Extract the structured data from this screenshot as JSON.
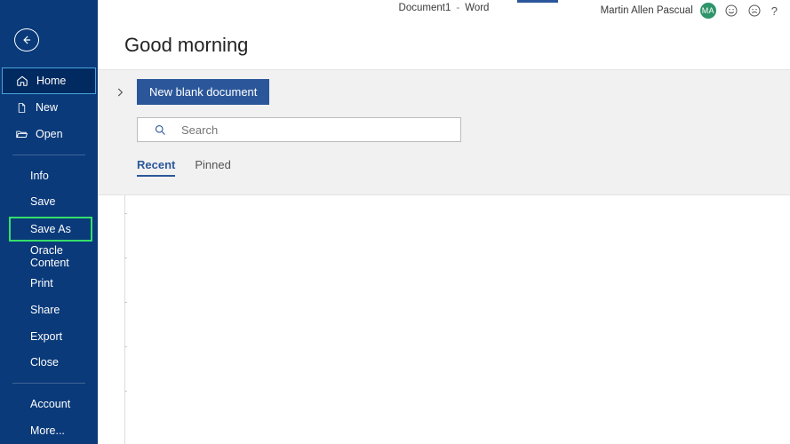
{
  "titlebar": {
    "document_name": "Document1",
    "separator": "-",
    "app_name": "Word",
    "user_name": "Martin Allen Pascual",
    "user_initials": "MA",
    "help_label": "?"
  },
  "sidebar": {
    "primary": [
      {
        "key": "home",
        "label": "Home"
      },
      {
        "key": "new",
        "label": "New"
      },
      {
        "key": "open",
        "label": "Open"
      }
    ],
    "secondary": [
      {
        "key": "info",
        "label": "Info"
      },
      {
        "key": "save",
        "label": "Save"
      },
      {
        "key": "saveas",
        "label": "Save As"
      },
      {
        "key": "oracle",
        "label": "Oracle Content"
      },
      {
        "key": "print",
        "label": "Print"
      },
      {
        "key": "share",
        "label": "Share"
      },
      {
        "key": "export",
        "label": "Export"
      },
      {
        "key": "close",
        "label": "Close"
      }
    ],
    "footer": [
      {
        "key": "account",
        "label": "Account"
      },
      {
        "key": "more",
        "label": "More..."
      }
    ]
  },
  "main": {
    "greeting": "Good morning",
    "template_button": "New blank document",
    "search": {
      "placeholder": "Search",
      "value": ""
    },
    "tabs": {
      "recent": "Recent",
      "pinned": "Pinned"
    }
  }
}
